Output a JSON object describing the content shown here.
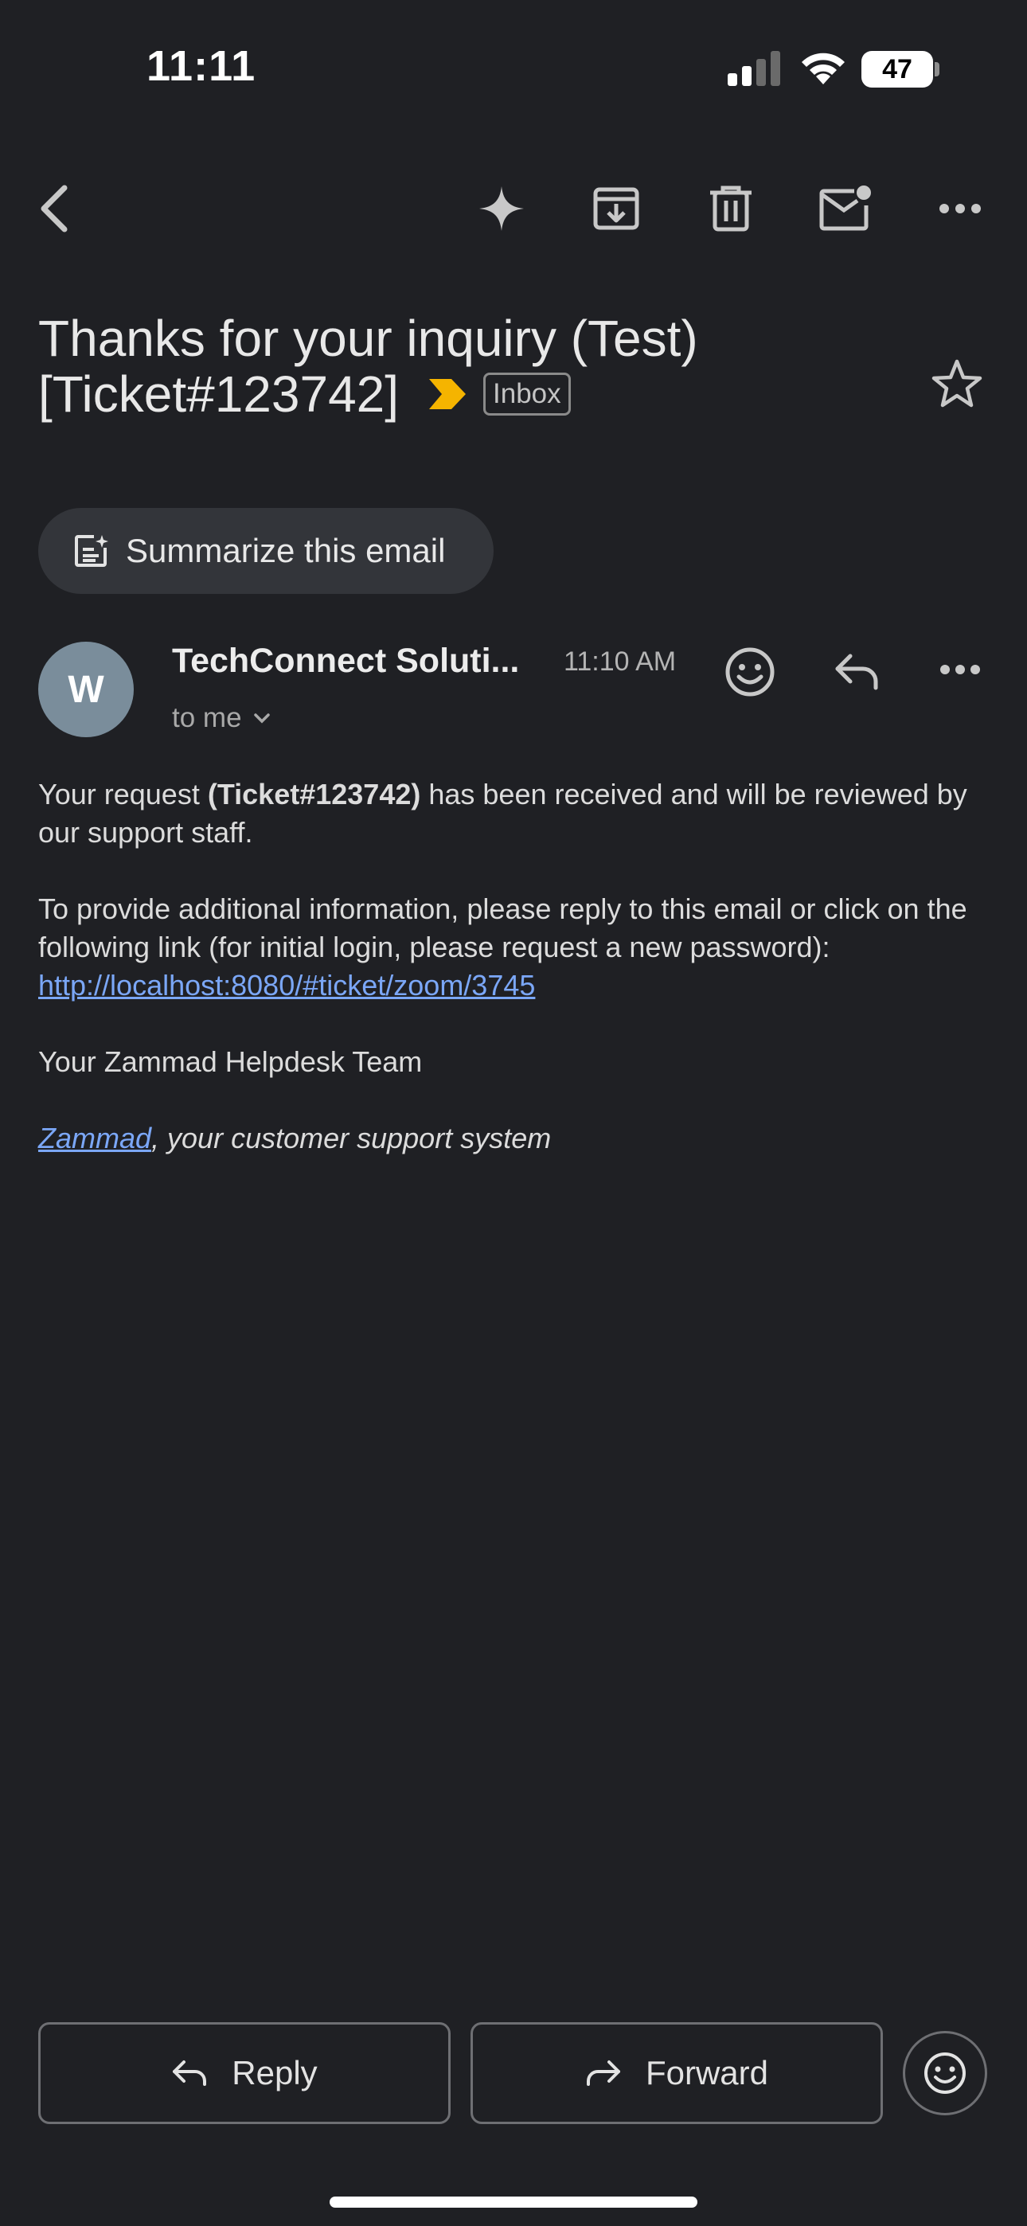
{
  "status_bar": {
    "time": "11:11",
    "battery": "47",
    "battery_level": 0.47
  },
  "toolbar": {
    "icons": [
      "back-icon",
      "sparkle-icon",
      "archive-icon",
      "trash-icon",
      "mark-unread-icon",
      "more-icon"
    ]
  },
  "email": {
    "subject_line1": "Thanks for your inquiry (Test)",
    "subject_line2": "[Ticket#123742]",
    "label": "Inbox",
    "summarize_label": "Summarize this email",
    "sender": {
      "avatar_letter": "W",
      "name": "TechConnect Soluti...",
      "time": "11:10 AM",
      "recipient": "to me"
    },
    "body": {
      "p1_before": "Your request ",
      "p1_bold": "(Ticket#123742)",
      "p1_after": " has been received and will be reviewed by our support staff.",
      "p2": "To provide additional information, please reply to this email or click on the following link (for initial login, please request a new password):",
      "p2_link": "http://localhost:8080/#ticket/zoom/3745",
      "p3": "Your Zammad Helpdesk Team",
      "p4_link": "Zammad",
      "p4_after": ", your customer support system"
    }
  },
  "actions": {
    "reply": "Reply",
    "forward": "Forward"
  },
  "colors": {
    "background": "#1f2024",
    "link": "#7ba7f7",
    "important_marker": "#f5b400",
    "avatar": "#7a8d9b"
  }
}
